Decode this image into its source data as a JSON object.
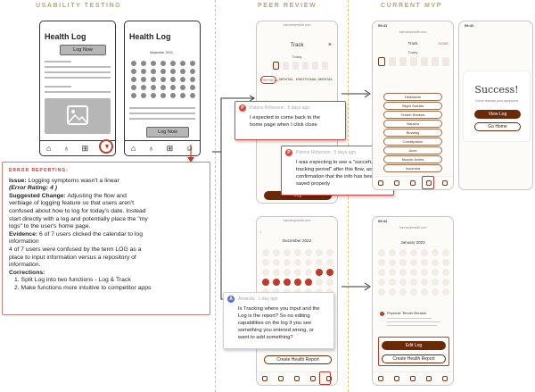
{
  "sections": {
    "usability": "USABILITY TESTING",
    "peer": "PEER REVIEW",
    "mvp": "CURRENT MVP"
  },
  "wireframes": {
    "title1": "Health Log",
    "btn1": "Log Now",
    "title2": "Health Log",
    "cal_month": "November 2023",
    "btn2": "Log Now"
  },
  "error_report": {
    "title": "ERROR REPORTING:",
    "issue_label": "Issue:",
    "issue_text": "Logging symptoms wasn't a linear",
    "rating": "(Error Rating: 4 )",
    "suggested_label": "Suggested Change:",
    "suggested_lines": [
      "Adjusting the flow and",
      "verbiage of logging feature so that users aren't",
      "confused about how to log for today's date. Instead",
      "start directly with a log and potentially place the \"my",
      "logs\" to the user's home page."
    ],
    "evidence_label": "Evidence:",
    "evidence_lines": [
      "6 of 7 users clicked the calendar to log",
      "information",
      "4 of 7 users were confused by the term LOG as a",
      "place to input information versus a repository of",
      "information."
    ],
    "corrections_label": "Corrections:",
    "corrections": [
      "1. Split Log into two functions - Log & Track",
      "2. Make functions more intuitive to competitor apps"
    ]
  },
  "peer": {
    "track_title": "Track",
    "today": "Today",
    "tabs": [
      "PHYSICAL",
      "MENTAL",
      "EMOTIONAL",
      "MENTAL"
    ],
    "log_btn": "Log",
    "cal_month": "December 2023",
    "create_report": "Create Health Report",
    "nav": [
      "Home",
      "Learn",
      "Tracker",
      "Track",
      "Logs"
    ]
  },
  "comments": [
    {
      "initial": "P",
      "author": "Patrice Roberson",
      "time": "5 days ago",
      "lines": [
        "I expected to come back to the",
        "home page when I click close"
      ]
    },
    {
      "initial": "P",
      "author": "Patrice Roberson",
      "time": "5 days ago",
      "lines": [
        "I was expecting to see a \"succefull",
        "tracking period\" after this flow, as a",
        "confirmation that the info has been",
        "saved properly"
      ]
    },
    {
      "initial": "A",
      "author": "Amanda",
      "time": "1 day ago",
      "lines": [
        "Is Tracking where you input and the",
        "Log is the report? So no editing",
        "capabilities on the log if you see",
        "something you entered wrong, or",
        "want to add something?"
      ]
    }
  ],
  "mvp": {
    "track_title": "Track",
    "done": "DONE",
    "today": "Today",
    "symptoms": [
      "Headache",
      "Slight Sweats",
      "Tender Breasts",
      "Nausea",
      "Bloating",
      "Constipation",
      "Acne",
      "Muscle Aches",
      "Insomnia"
    ],
    "success_title": "Success!",
    "success_sub": "You've tracked your symptoms",
    "view_log": "View Log",
    "go_home": "Go Home",
    "cal_month": "January 2023",
    "entry_title": "Physical: Tender Breasts",
    "edit_log": "Edit Log",
    "create_report": "Create Health Report",
    "nav": [
      "Home",
      "Learn",
      "Tracker",
      "Track",
      "Logs"
    ]
  },
  "colors": {
    "accent_gold": "#e8c470",
    "error_red": "#c0392b",
    "brown": "#6a2a0a"
  }
}
